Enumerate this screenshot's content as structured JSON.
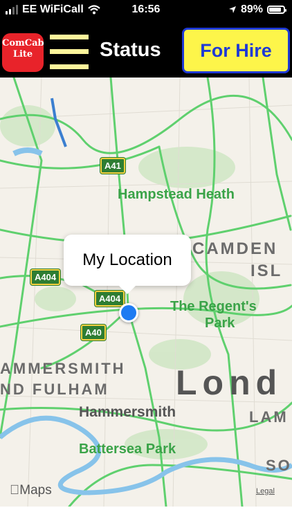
{
  "status_bar": {
    "carrier": "EE WiFiCall",
    "time": "16:56",
    "battery": "89%",
    "icons": [
      "signal-bars-icon",
      "wifi-icon",
      "location-arrow-icon",
      "battery-icon"
    ]
  },
  "toolbar": {
    "logo_line1": "ComCab",
    "logo_line2": "Lite",
    "menu_icon": "hamburger-menu-icon",
    "status_label": "Status",
    "hire_button": "For Hire",
    "colors": {
      "logo": "#e8232a",
      "menu": "#fdf59b",
      "hire_bg": "#fdf54a",
      "hire_text": "#1f3ad6"
    }
  },
  "map": {
    "road_labels": [
      "A41",
      "A404",
      "A404",
      "A40"
    ],
    "parks": [
      "Hampstead Heath",
      "The Regent's",
      "Park",
      "Battersea Park"
    ],
    "areas": [
      "CAMDEN",
      "ISL",
      "AMMERSMITH",
      "ND FULHAM",
      "Hammersmith",
      "Lond",
      "LAM",
      "SO"
    ],
    "callout": "My Location",
    "brand": "Maps",
    "legal": "Legal"
  }
}
